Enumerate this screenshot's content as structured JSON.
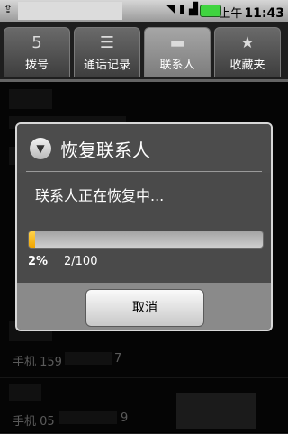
{
  "status_bar": {
    "time_prefix": "上午",
    "time": "11:43",
    "icons": [
      "usb-icon",
      "wifi-icon",
      "sd-card-icon",
      "signal-icon",
      "battery-icon"
    ],
    "battery_color": "#3fd43f"
  },
  "tabs": [
    {
      "label": "拨号",
      "icon": "dialpad-icon",
      "icon_glyph": "5",
      "active": false
    },
    {
      "label": "通话记录",
      "icon": "call-log-icon",
      "icon_glyph": "☰",
      "active": false
    },
    {
      "label": "联系人",
      "icon": "contacts-folder-icon",
      "icon_glyph": "▬",
      "active": true
    },
    {
      "label": "收藏夹",
      "icon": "star-icon",
      "icon_glyph": "★",
      "active": false
    }
  ],
  "contacts": [
    {
      "phone": "手机 159",
      "phone_tail": "7"
    },
    {
      "phone": "手机 05",
      "phone_tail": "9"
    }
  ],
  "dialog": {
    "title": "恢复联系人",
    "message": "联系人正在恢复中...",
    "progress_fraction": 0.02,
    "percent_text": "2%",
    "count_text": "2/100",
    "cancel_label": "取消",
    "accent_color": "#f5b800"
  }
}
